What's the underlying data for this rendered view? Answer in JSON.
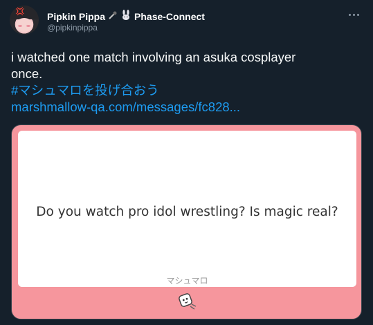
{
  "author": {
    "name": "Pipkin Pippa",
    "badge_text": "Phase-Connect",
    "handle": "@pipkinpippa"
  },
  "tweet": {
    "text_lines": [
      "i watched one match involving an asuka cosplayer",
      "once."
    ],
    "hashtag": "#マシュマロを投げ合おう",
    "link": "marshmallow-qa.com/messages/fc828..."
  },
  "card": {
    "question": "Do you watch pro idol wrestling? Is magic real?",
    "brand": "マシュマロ",
    "colors": {
      "frame": "#f6969d",
      "inner": "#ffffff"
    }
  },
  "icons": [
    "more-icon",
    "microphone-icon",
    "rabbit-icon",
    "marshmallow-mascot-icon"
  ],
  "theme": {
    "background": "#15202b",
    "link": "#1d9bf0",
    "muted": "#8b98a5"
  }
}
